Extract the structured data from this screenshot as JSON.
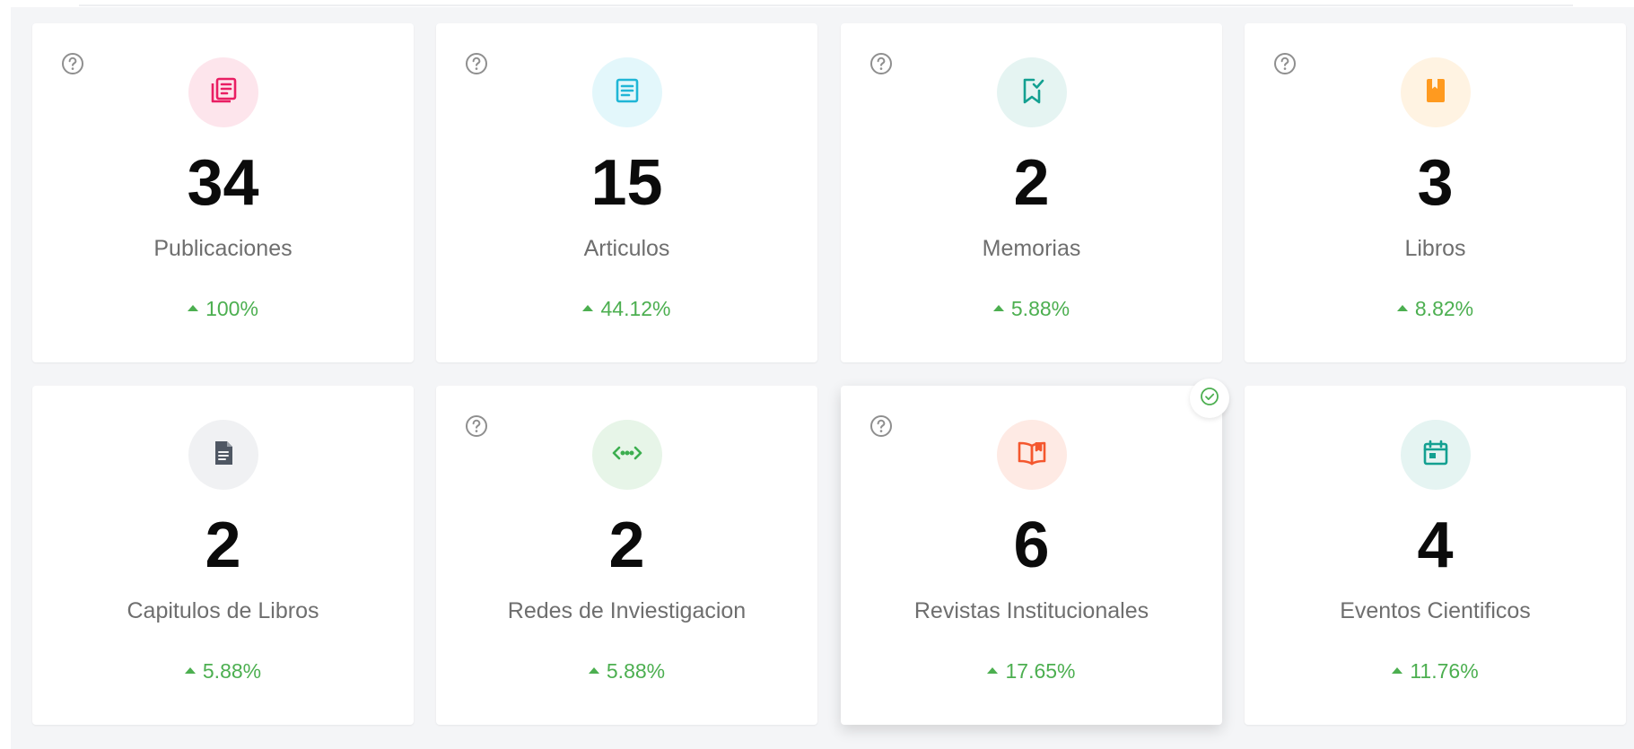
{
  "colors": {
    "positive": "#4caf50",
    "help_icon": "#8f8f8f"
  },
  "cards": [
    {
      "value": "34",
      "label": "Publicaciones",
      "delta": "100%",
      "icon": "publications-icon",
      "icon_color": "#e91e63",
      "icon_bg": "#fde5ec",
      "has_help": true
    },
    {
      "value": "15",
      "label": "Articulos",
      "delta": "44.12%",
      "icon": "article-icon",
      "icon_color": "#1fb6d6",
      "icon_bg": "#e3f7fb",
      "has_help": true
    },
    {
      "value": "2",
      "label": "Memorias",
      "delta": "5.88%",
      "icon": "bookmark-check-icon",
      "icon_color": "#13a091",
      "icon_bg": "#e5f4f2",
      "has_help": true
    },
    {
      "value": "3",
      "label": "Libros",
      "delta": "8.82%",
      "icon": "book-icon",
      "icon_color": "#ff9a1f",
      "icon_bg": "#fff3e2",
      "has_help": true
    },
    {
      "value": "2",
      "label": "Capitulos de Libros",
      "delta": "5.88%",
      "icon": "document-icon",
      "icon_color": "#4f5763",
      "icon_bg": "#f0f1f3",
      "has_help": false
    },
    {
      "value": "2",
      "label": "Redes de Inviestigacion",
      "delta": "5.88%",
      "icon": "network-icon",
      "icon_color": "#3cae4f",
      "icon_bg": "#e7f5e8",
      "has_help": true
    },
    {
      "value": "6",
      "label": "Revistas Institucionales",
      "delta": "17.65%",
      "icon": "open-book-icon",
      "icon_color": "#f4572e",
      "icon_bg": "#feeae4",
      "has_help": true
    },
    {
      "value": "4",
      "label": "Eventos Cientificos",
      "delta": "11.76%",
      "icon": "calendar-icon",
      "icon_color": "#13a091",
      "icon_bg": "#e5f4f2",
      "has_help": false
    }
  ]
}
